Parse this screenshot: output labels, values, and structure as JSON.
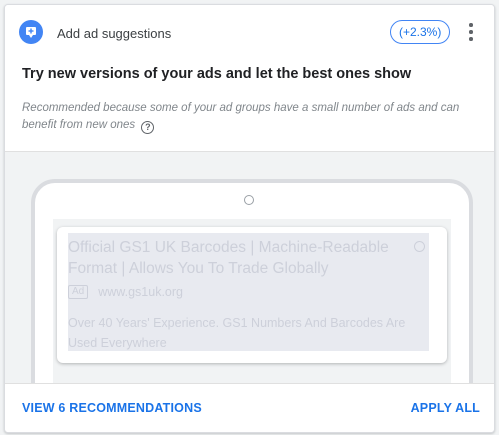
{
  "card": {
    "type_icon": "ad-suggestion-icon",
    "type_label": "Add ad suggestions",
    "uplift_badge": "(+2.3%)",
    "more_icon": "more-vert-icon",
    "title": "Try new versions of your ads and let the best ones show",
    "reason_text": "Recommended because some of your ad groups have a small number of ads and can benefit from new ones",
    "help_icon": "help-circle-icon",
    "help_glyph": "?"
  },
  "ad_preview": {
    "headline": "Official GS1 UK Barcodes | Machine-Readable Format | Allows You To Trade Globally",
    "ad_label": "Ad",
    "display_url": "www.gs1uk.org",
    "description": "Over 40 Years' Experience. GS1 Numbers And Barcodes Are Used Everywhere",
    "info_icon": "info-icon"
  },
  "footer": {
    "view_label": "VIEW 6 RECOMMENDATIONS",
    "apply_label": "APPLY ALL"
  },
  "colors": {
    "accent": "#1a73e8",
    "icon_blue": "#4285f4",
    "faded_text": "#cdd0da"
  }
}
